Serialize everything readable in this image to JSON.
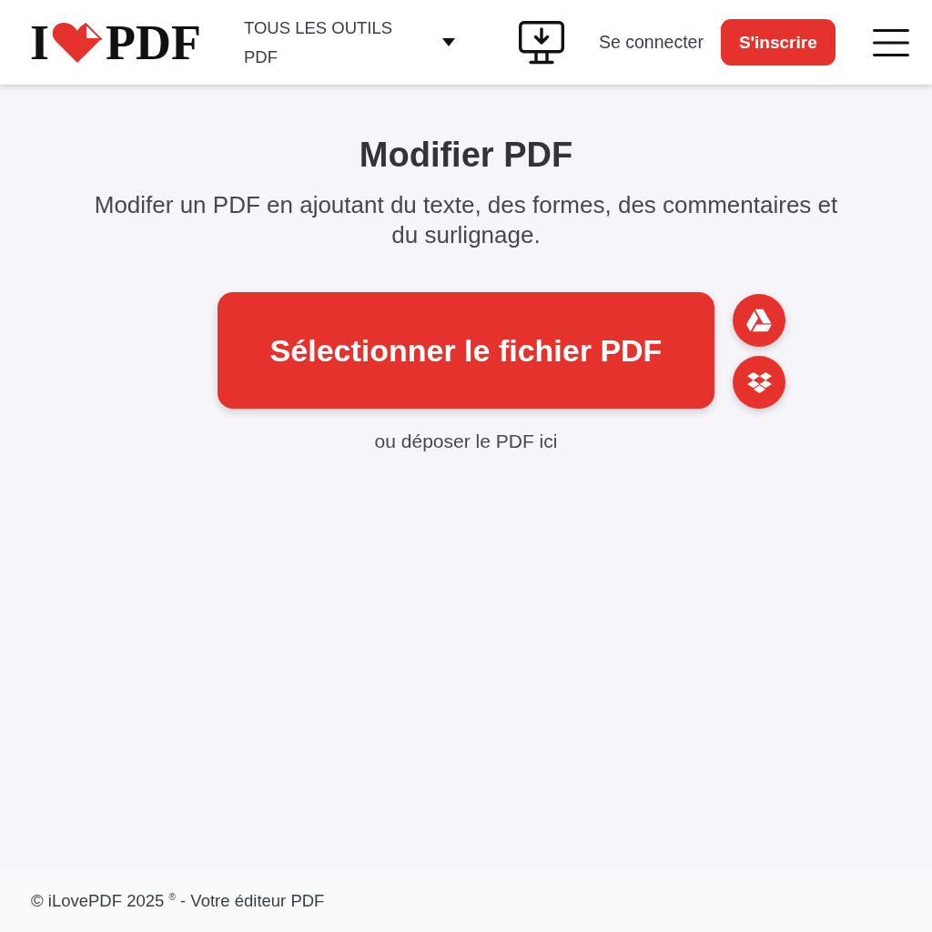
{
  "header": {
    "logo": {
      "letter": "I",
      "word": "PDF"
    },
    "tools_menu": "TOUS LES OUTILS PDF",
    "sign_in": "Se connecter",
    "sign_up": "S'inscrire"
  },
  "main": {
    "title": "Modifier PDF",
    "description": "Modifer un PDF en ajoutant du texte, des formes, des commentaires et du surlignage.",
    "select_button": "Sélectionner le fichier PDF",
    "cloud_sources": [
      {
        "kind": "drive"
      },
      {
        "kind": "dropbox"
      }
    ],
    "drop_hint": "ou déposer le PDF ici"
  },
  "footer": {
    "copyright": "© iLovePDF 2025 $^{®}$ - Votre éditeur PDF"
  }
}
